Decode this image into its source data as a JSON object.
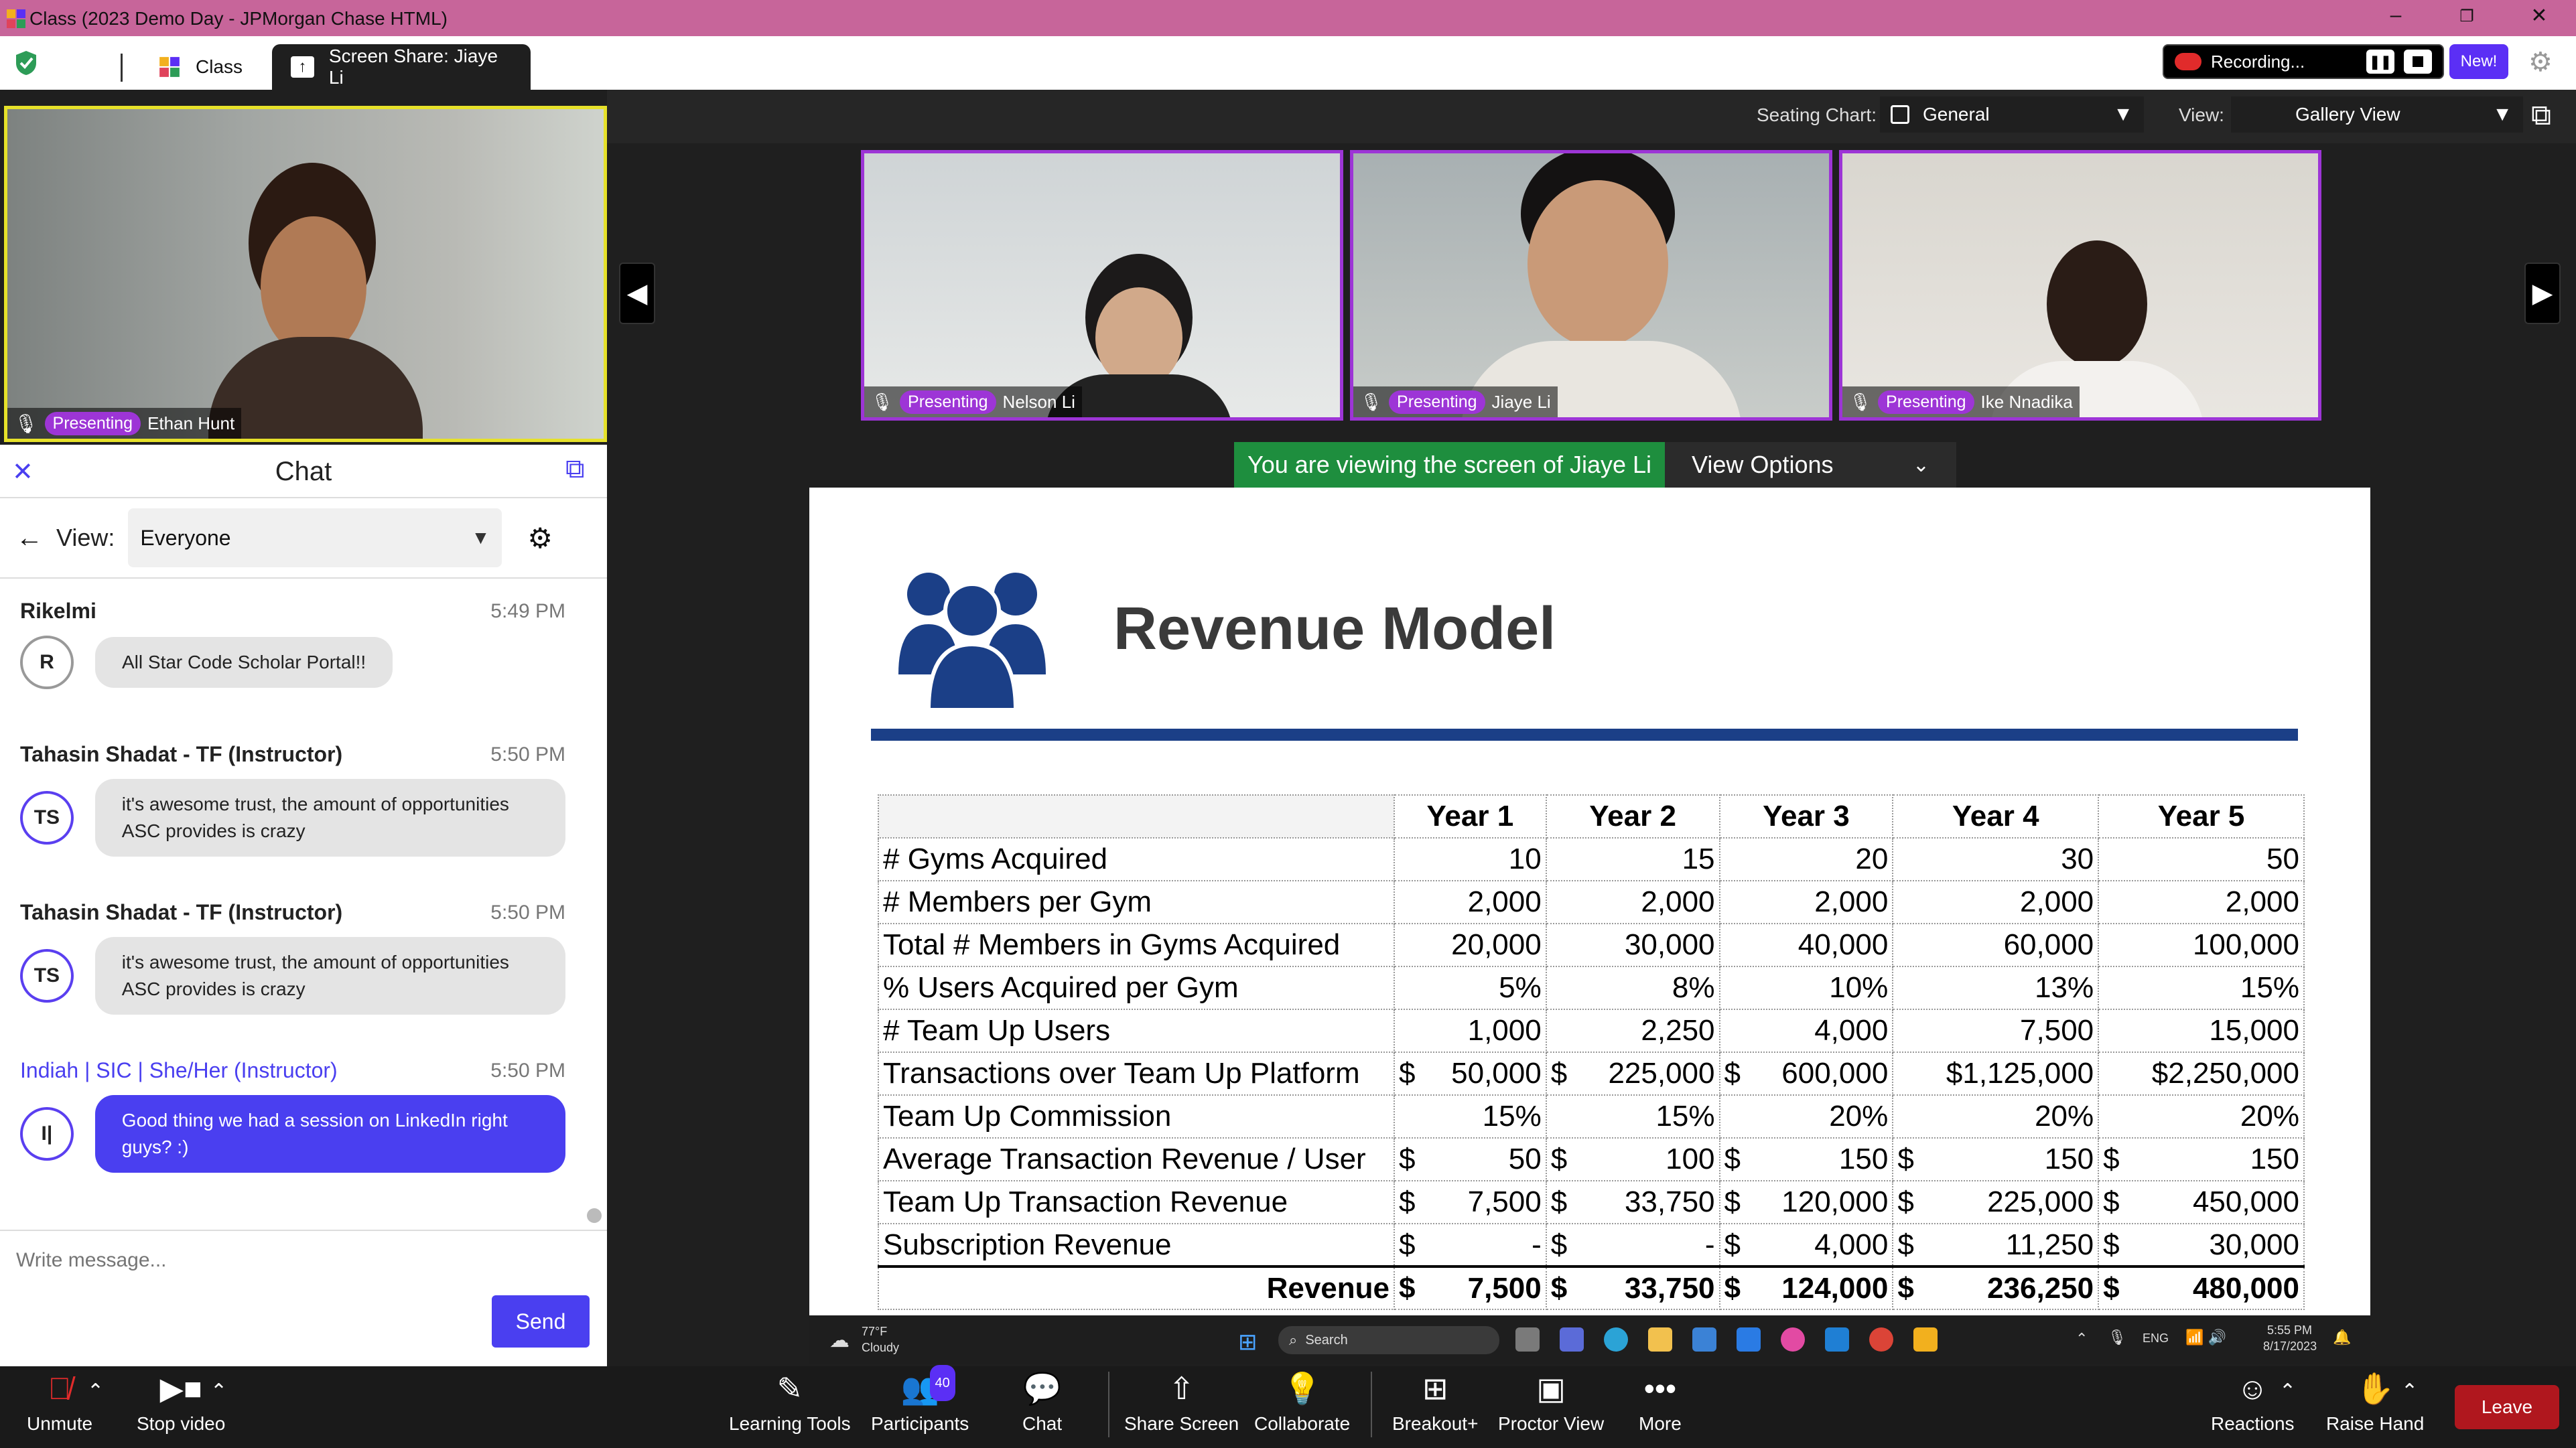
{
  "window": {
    "title": "Class (2023 Demo Day - JPMorgan Chase HTML)"
  },
  "tabs": [
    {
      "label": "Class"
    },
    {
      "label": "Screen Share: Jiaye Li"
    }
  ],
  "recording": {
    "label": "Recording...",
    "new_label": "New!"
  },
  "seating": {
    "label": "Seating Chart:",
    "value": "General",
    "view_label": "View:",
    "view_value": "Gallery View"
  },
  "self_video": {
    "badge": "Presenting",
    "name": "Ethan Hunt"
  },
  "gallery": [
    {
      "badge": "Presenting",
      "name": "Nelson Li"
    },
    {
      "badge": "Presenting",
      "name": "Jiaye Li"
    },
    {
      "badge": "Presenting",
      "name": "Ike Nnadika"
    }
  ],
  "banner": {
    "text": "You are viewing the screen of Jiaye Li",
    "options": "View Options"
  },
  "chat": {
    "title": "Chat",
    "view_label": "View:",
    "view_value": "Everyone",
    "messages": [
      {
        "name": "Rikelmi",
        "time": "5:49 PM",
        "initials": "R",
        "text": "All Star Code Scholar Portal!!"
      },
      {
        "name": "Tahasin Shadat - TF (Instructor)",
        "time": "5:50 PM",
        "initials": "TS",
        "text": "it's awesome trust, the amount of opportunities ASC provides is crazy"
      },
      {
        "name": "Tahasin Shadat - TF (Instructor)",
        "time": "5:50 PM",
        "initials": "TS",
        "text": "it's awesome trust, the amount of opportunities ASC provides is crazy"
      },
      {
        "name": "Indiah | SIC | She/Her (Instructor)",
        "time": "5:50 PM",
        "initials": "I|",
        "text": "Good thing we had a session on LinkedIn right guys? :)"
      }
    ],
    "input_placeholder": "Write message...",
    "send_label": "Send"
  },
  "slide": {
    "title": "Revenue Model",
    "headers": [
      "",
      "Year 1",
      "Year 2",
      "Year 3",
      "Year 4",
      "Year 5"
    ],
    "rows": [
      {
        "label": "# Gyms Acquired",
        "cells": [
          [
            "",
            "10"
          ],
          [
            "",
            "15"
          ],
          [
            "",
            "20"
          ],
          [
            "",
            "30"
          ],
          [
            "",
            "50"
          ]
        ]
      },
      {
        "label": "# Members per Gym",
        "cells": [
          [
            "",
            "2,000"
          ],
          [
            "",
            "2,000"
          ],
          [
            "",
            "2,000"
          ],
          [
            "",
            "2,000"
          ],
          [
            "",
            "2,000"
          ]
        ]
      },
      {
        "label": "Total # Members in Gyms Acquired",
        "cells": [
          [
            "",
            "20,000"
          ],
          [
            "",
            "30,000"
          ],
          [
            "",
            "40,000"
          ],
          [
            "",
            "60,000"
          ],
          [
            "",
            "100,000"
          ]
        ]
      },
      {
        "label": "% Users Acquired per Gym",
        "cells": [
          [
            "",
            "5%"
          ],
          [
            "",
            "8%"
          ],
          [
            "",
            "10%"
          ],
          [
            "",
            "13%"
          ],
          [
            "",
            "15%"
          ]
        ]
      },
      {
        "label": "# Team Up Users",
        "cells": [
          [
            "",
            "1,000"
          ],
          [
            "",
            "2,250"
          ],
          [
            "",
            "4,000"
          ],
          [
            "",
            "7,500"
          ],
          [
            "",
            "15,000"
          ]
        ]
      },
      {
        "label": "Transactions over Team Up Platform",
        "cells": [
          [
            "$",
            "50,000"
          ],
          [
            "$",
            "225,000"
          ],
          [
            "$",
            "600,000"
          ],
          [
            "",
            "$1,125,000"
          ],
          [
            "",
            "$2,250,000"
          ]
        ]
      },
      {
        "label": "Team Up Commission",
        "cells": [
          [
            "",
            "15%"
          ],
          [
            "",
            "15%"
          ],
          [
            "",
            "20%"
          ],
          [
            "",
            "20%"
          ],
          [
            "",
            "20%"
          ]
        ]
      },
      {
        "label": "Average Transaction Revenue / User",
        "cells": [
          [
            "$",
            "50"
          ],
          [
            "$",
            "100"
          ],
          [
            "$",
            "150"
          ],
          [
            "$",
            "150"
          ],
          [
            "$",
            "150"
          ]
        ]
      },
      {
        "label": "Team Up Transaction Revenue",
        "cells": [
          [
            "$",
            "7,500"
          ],
          [
            "$",
            "33,750"
          ],
          [
            "$",
            "120,000"
          ],
          [
            "$",
            "225,000"
          ],
          [
            "$",
            "450,000"
          ]
        ]
      },
      {
        "label": "Subscription Revenue",
        "cells": [
          [
            "$",
            "-"
          ],
          [
            "$",
            "-"
          ],
          [
            "$",
            "4,000"
          ],
          [
            "$",
            "11,250"
          ],
          [
            "$",
            "30,000"
          ]
        ]
      }
    ],
    "total": {
      "label": "Revenue",
      "cells": [
        [
          "$",
          "7,500"
        ],
        [
          "$",
          "33,750"
        ],
        [
          "$",
          "124,000"
        ],
        [
          "$",
          "236,250"
        ],
        [
          "$",
          "480,000"
        ]
      ]
    }
  },
  "win_taskbar": {
    "weather_temp": "77°F",
    "weather_desc": "Cloudy",
    "search": "Search",
    "lang": "ENG",
    "time": "5:55 PM",
    "date": "8/17/2023"
  },
  "toolbar": {
    "unmute": "Unmute",
    "stop_video": "Stop video",
    "learning_tools": "Learning Tools",
    "participants": "Participants",
    "participants_count": "40",
    "chat": "Chat",
    "share_screen": "Share Screen",
    "collaborate": "Collaborate",
    "breakout": "Breakout+",
    "proctor_view": "Proctor View",
    "more": "More",
    "reactions": "Reactions",
    "raise_hand": "Raise Hand",
    "leave": "Leave"
  },
  "colors": {
    "accent": "#9d35d6",
    "chat_mine": "#4a3ff0",
    "banner_green": "#1e8e3e",
    "leave_red": "#b0171e",
    "slide_line": "#1b3f87"
  }
}
